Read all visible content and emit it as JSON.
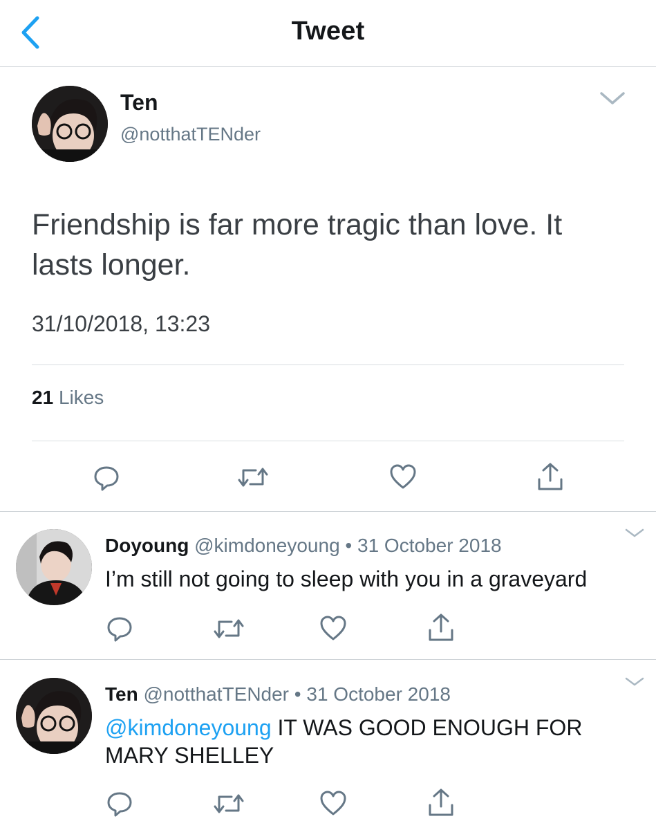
{
  "nav": {
    "title": "Tweet"
  },
  "tweet": {
    "name": "Ten",
    "handle": "@notthatTENder",
    "text": "Friendship is far more tragic than love. It lasts longer.",
    "timestamp": "31/10/2018, 13:23",
    "likes_count": "21",
    "likes_label": "Likes"
  },
  "replies": [
    {
      "name": "Doyoung",
      "handle": "@kimdoneyoung",
      "date": "• 31 October 2018",
      "text": "I’m still not going to sleep with you in a graveyard"
    },
    {
      "name": "Ten",
      "handle": "@notthatTENder",
      "date": "• 31 October 2018",
      "mention": "@kimdoneyoung",
      "text": " IT WAS GOOD ENOUGH FOR MARY SHELLEY"
    }
  ],
  "colors": {
    "accent": "#1da1f2",
    "secondary_text": "#657786",
    "icon": "#657786",
    "divider": "#cfd4d8"
  }
}
